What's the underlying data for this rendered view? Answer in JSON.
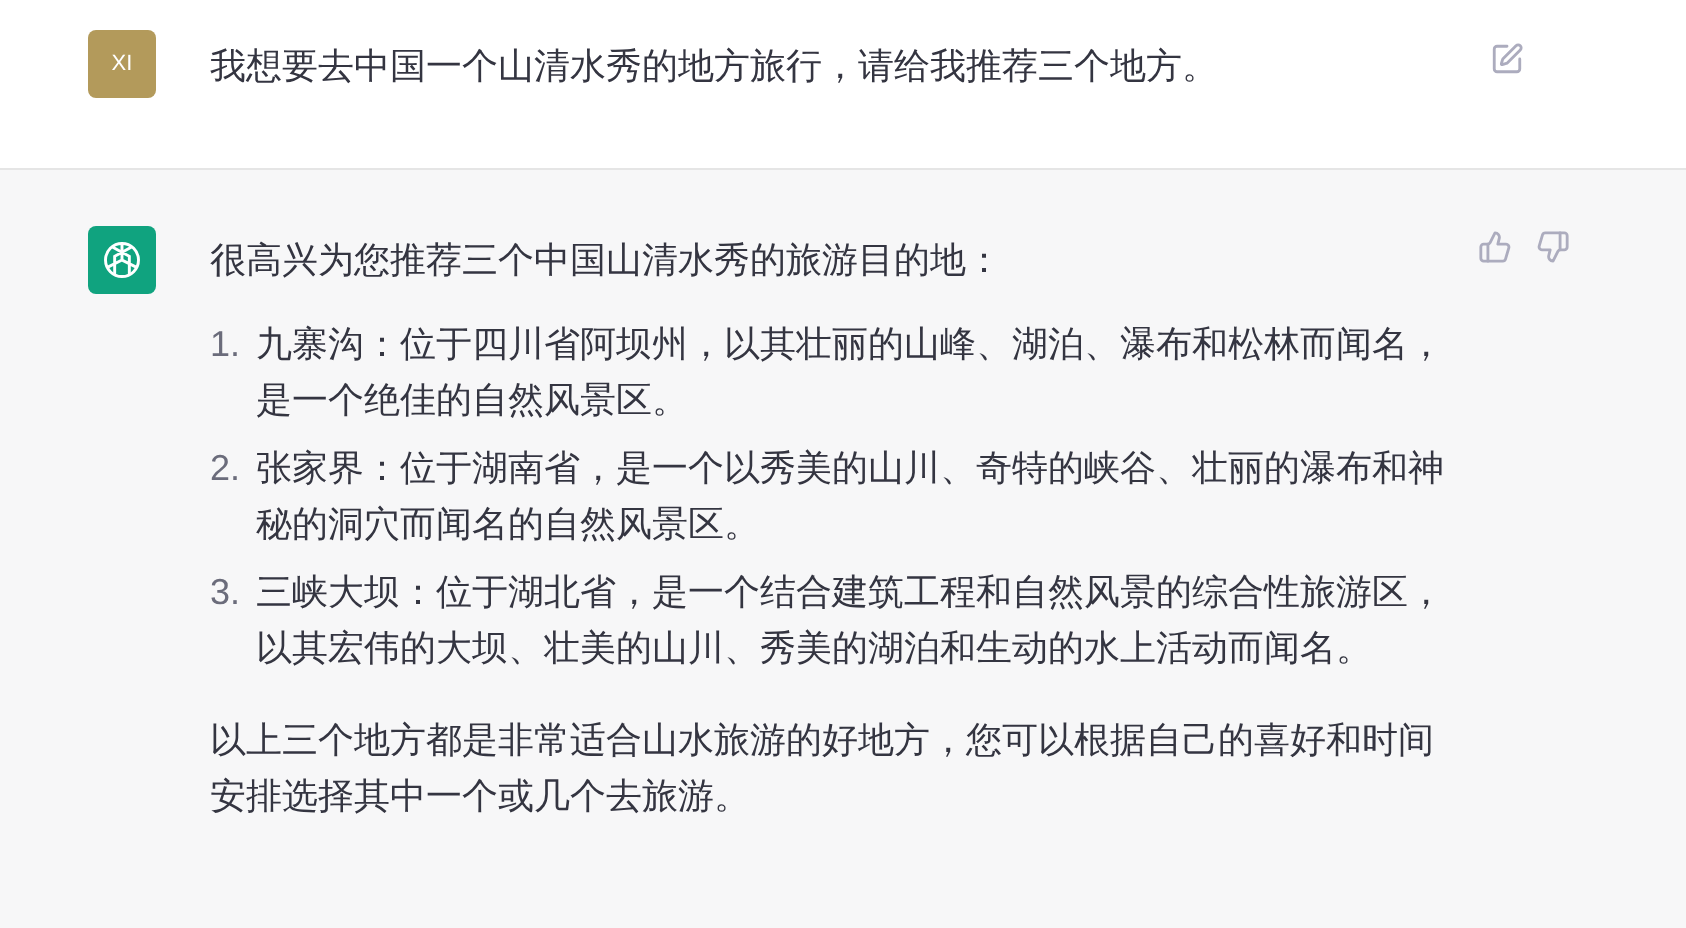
{
  "messages": [
    {
      "kind": "user",
      "avatar": "XI",
      "text": "我想要去中国一个山清水秀的地方旅行，请给我推荐三个地方。"
    },
    {
      "kind": "assistant",
      "intro": "很高兴为您推荐三个中国山清水秀的旅游目的地：",
      "list": [
        {
          "number": "1.",
          "text": "九寨沟：位于四川省阿坝州，以其壮丽的山峰、湖泊、瀑布和松林而闻名，是一个绝佳的自然风景区。"
        },
        {
          "number": "2.",
          "text": "张家界：位于湖南省，是一个以秀美的山川、奇特的峡谷、壮丽的瀑布和神秘的洞穴而闻名的自然风景区。"
        },
        {
          "number": "3.",
          "text": "三峡大坝：位于湖北省，是一个结合建筑工程和自然风景的综合性旅游区，以其宏伟的大坝、壮美的山川、秀美的湖泊和生动的水上活动而闻名。"
        }
      ],
      "outro": "以上三个地方都是非常适合山水旅游的好地方，您可以根据自己的喜好和时间安排选择其中一个或几个去旅游。"
    }
  ]
}
